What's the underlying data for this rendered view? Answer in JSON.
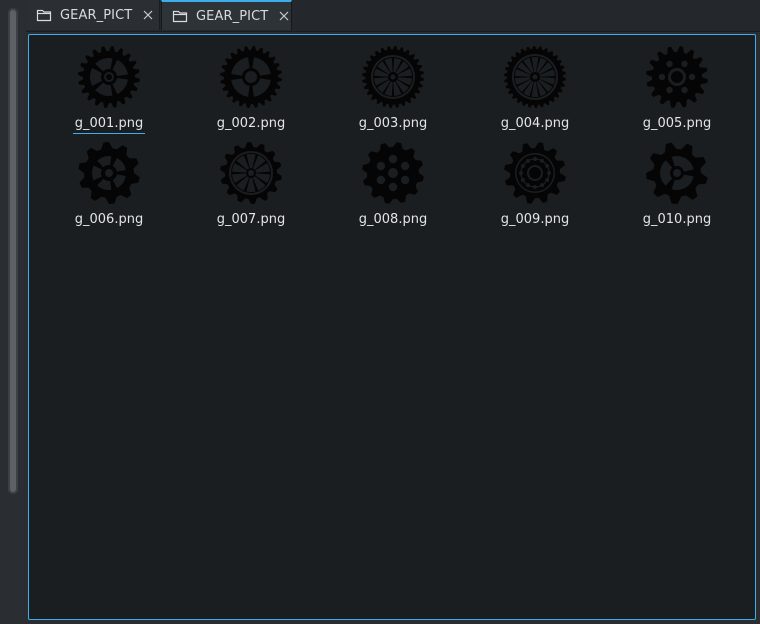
{
  "tabs": [
    {
      "label": "GEAR_PICT",
      "state": "inactive",
      "icon": "folder-icon"
    },
    {
      "label": "GEAR_PICT",
      "state": "active",
      "icon": "folder-icon"
    }
  ],
  "files": [
    {
      "name": "g_001.png",
      "icon": "gear-icon",
      "selected": true
    },
    {
      "name": "g_002.png",
      "icon": "gear-icon"
    },
    {
      "name": "g_003.png",
      "icon": "gear-icon"
    },
    {
      "name": "g_004.png",
      "icon": "gear-icon"
    },
    {
      "name": "g_005.png",
      "icon": "gear-icon"
    },
    {
      "name": "g_006.png",
      "icon": "gear-icon"
    },
    {
      "name": "g_007.png",
      "icon": "gear-icon"
    },
    {
      "name": "g_008.png",
      "icon": "gear-icon"
    },
    {
      "name": "g_009.png",
      "icon": "gear-icon"
    },
    {
      "name": "g_010.png",
      "icon": "gear-icon"
    }
  ],
  "colors": {
    "accent": "#3daee9",
    "view_background": "#1b1e20",
    "text": "#e2e4e6"
  }
}
